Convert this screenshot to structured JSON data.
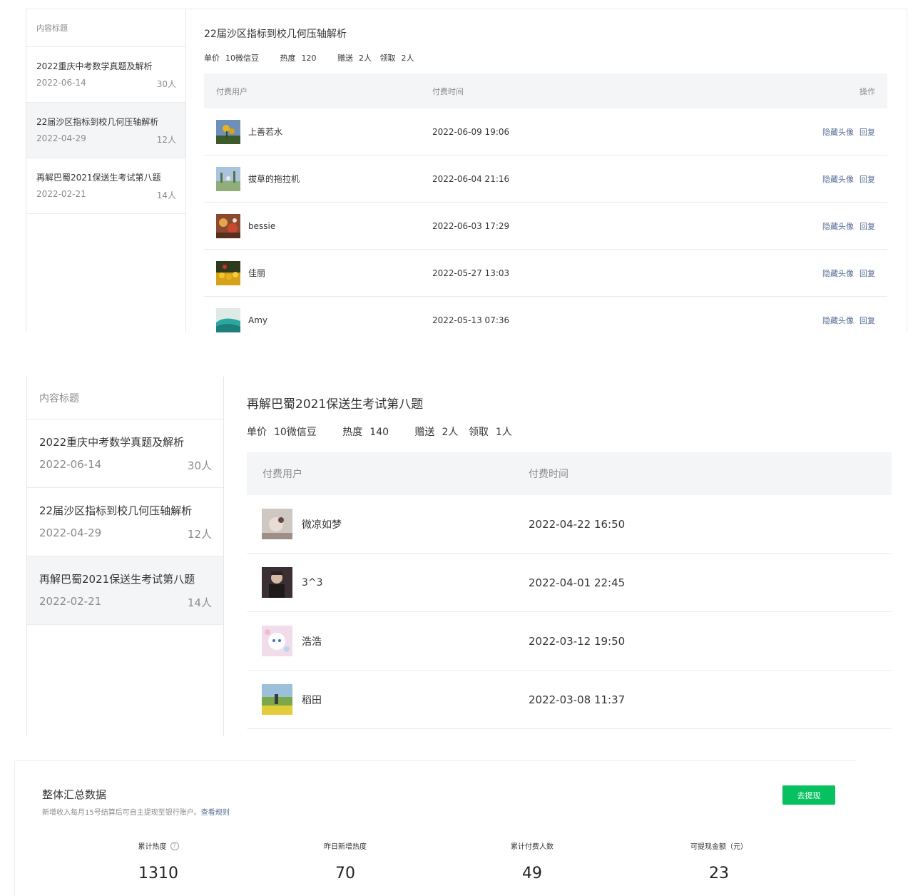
{
  "sidebar_header": "内容标题",
  "sidebar_items": [
    {
      "title": "2022重庆中考数学真题及解析",
      "date": "2022-06-14",
      "count": "30人"
    },
    {
      "title": "22届沙区指标到校几何压轴解析",
      "date": "2022-04-29",
      "count": "12人"
    },
    {
      "title": "再解巴蜀2021保送生考试第八题",
      "date": "2022-02-21",
      "count": "14人"
    }
  ],
  "columns": {
    "user": "付费用户",
    "time": "付费时间",
    "ops": "操作"
  },
  "ops_labels": {
    "hide_avatar": "隐藏头像",
    "reply": "回复"
  },
  "stat_labels": {
    "price": "单价",
    "heat": "热度",
    "gift": "赠送",
    "claim": "领取"
  },
  "panel1": {
    "title": "22届沙区指标到校几何压轴解析",
    "price": "10微信豆",
    "heat": "120",
    "gift": "2人",
    "claim": "2人",
    "rows": [
      {
        "user": "上善若水",
        "time": "2022-06-09 19:06"
      },
      {
        "user": "拔草的拖拉机",
        "time": "2022-06-04 21:16"
      },
      {
        "user": "bessie",
        "time": "2022-06-03 17:29"
      },
      {
        "user": "佳丽",
        "time": "2022-05-27 13:03"
      },
      {
        "user": "Amy",
        "time": "2022-05-13 07:36"
      }
    ]
  },
  "panel2": {
    "title": "再解巴蜀2021保送生考试第八题",
    "price": "10微信豆",
    "heat": "140",
    "gift": "2人",
    "claim": "1人",
    "rows": [
      {
        "user": "微凉如梦",
        "time": "2022-04-22 16:50"
      },
      {
        "user": "3^3",
        "time": "2022-04-01 22:45"
      },
      {
        "user": "浩浩",
        "time": "2022-03-12 19:50"
      },
      {
        "user": "稻田",
        "time": "2022-03-08 11:37"
      }
    ]
  },
  "summary": {
    "title": "整体汇总数据",
    "desc": "新增收入每月15号结算后可自主提现至银行账户。",
    "rules_link": "查看规则",
    "withdraw_button": "去提现",
    "help_icon": "?",
    "stats": [
      {
        "label": "累计热度",
        "value": "1310"
      },
      {
        "label": "昨日新增热度",
        "value": "70"
      },
      {
        "label": "累计付费人数",
        "value": "49"
      },
      {
        "label": "可提现金额（元）",
        "value": "23"
      }
    ]
  },
  "colors": {
    "accent": "#07c160",
    "link": "#576b95"
  }
}
